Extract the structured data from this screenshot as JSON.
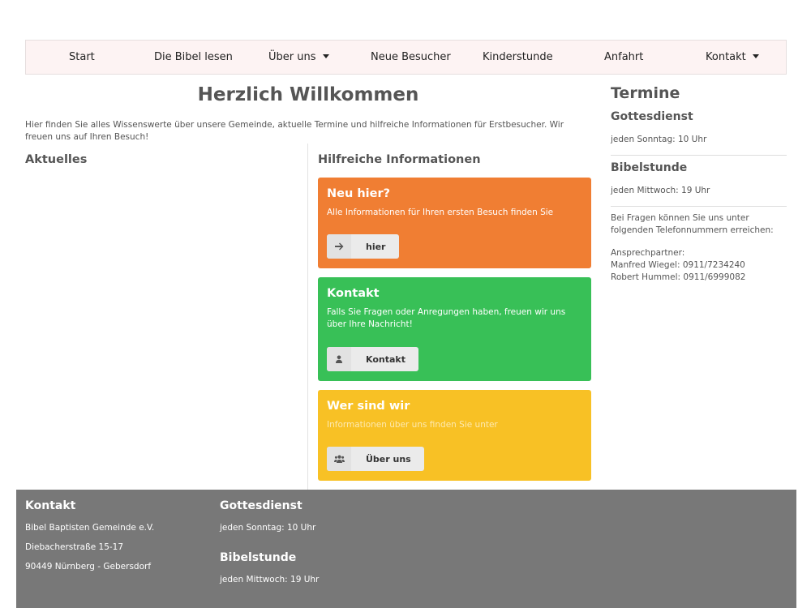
{
  "nav": {
    "items": [
      {
        "label": "Start",
        "dropdown": false
      },
      {
        "label": "Die Bibel lesen",
        "dropdown": false
      },
      {
        "label": "Über uns",
        "dropdown": true
      },
      {
        "label": "Neue Besucher",
        "dropdown": false
      },
      {
        "label": "Kinderstunde",
        "dropdown": false
      },
      {
        "label": "Anfahrt",
        "dropdown": false
      },
      {
        "label": "Kontakt",
        "dropdown": true
      }
    ]
  },
  "main": {
    "title": "Herzlich Willkommen",
    "intro": "Hier finden Sie alles Wissenswerte über unsere Gemeinde, aktuelle Termine und hilfreiche Informationen für Erstbesucher. Wir freuen uns auf Ihren Besuch!",
    "aktuelles_heading": "Aktuelles",
    "hilfreiche_heading": "Hilfreiche Informationen",
    "cards": [
      {
        "title": "Neu hier?",
        "text": "Alle Informationen für Ihren ersten Besuch finden Sie",
        "button": "hier",
        "icon": "arrow-right-icon",
        "color": "#f07e33"
      },
      {
        "title": "Kontakt",
        "text": "Falls Sie Fragen oder Anregungen haben, freuen wir uns über Ihre Nachricht!",
        "button": "Kontakt",
        "icon": "user-icon",
        "color": "#38c057"
      },
      {
        "title": "Wer sind wir",
        "text": "Informationen über uns finden Sie unter",
        "button": "Über uns",
        "icon": "users-icon",
        "color": "#f8c125"
      }
    ]
  },
  "sidebar": {
    "title": "Termine",
    "gottesdienst_heading": "Gottesdienst",
    "gottesdienst_time": "jeden Sonntag: 10 Uhr",
    "bibelstunde_heading": "Bibelstunde",
    "bibelstunde_time": "jeden Mittwoch: 19 Uhr",
    "questions_text": "Bei Fragen können Sie uns unter folgenden Telefonnummern erreichen:",
    "contact_label": "Ansprechpartner:",
    "contact_1": "Manfred Wiegel: 0911/7234240",
    "contact_2": "Robert Hummel: 0911/6999082"
  },
  "footer": {
    "kontakt_heading": "Kontakt",
    "org_name": "Bibel Baptisten Gemeinde e.V.",
    "street": "Diebacherstraße 15-17",
    "city": "90449 Nürnberg - Gebersdorf",
    "gottesdienst_heading": "Gottesdienst",
    "gottesdienst_time": "jeden Sonntag: 10 Uhr",
    "bibelstunde_heading": "Bibelstunde",
    "bibelstunde_time": "jeden Mittwoch: 19 Uhr"
  }
}
